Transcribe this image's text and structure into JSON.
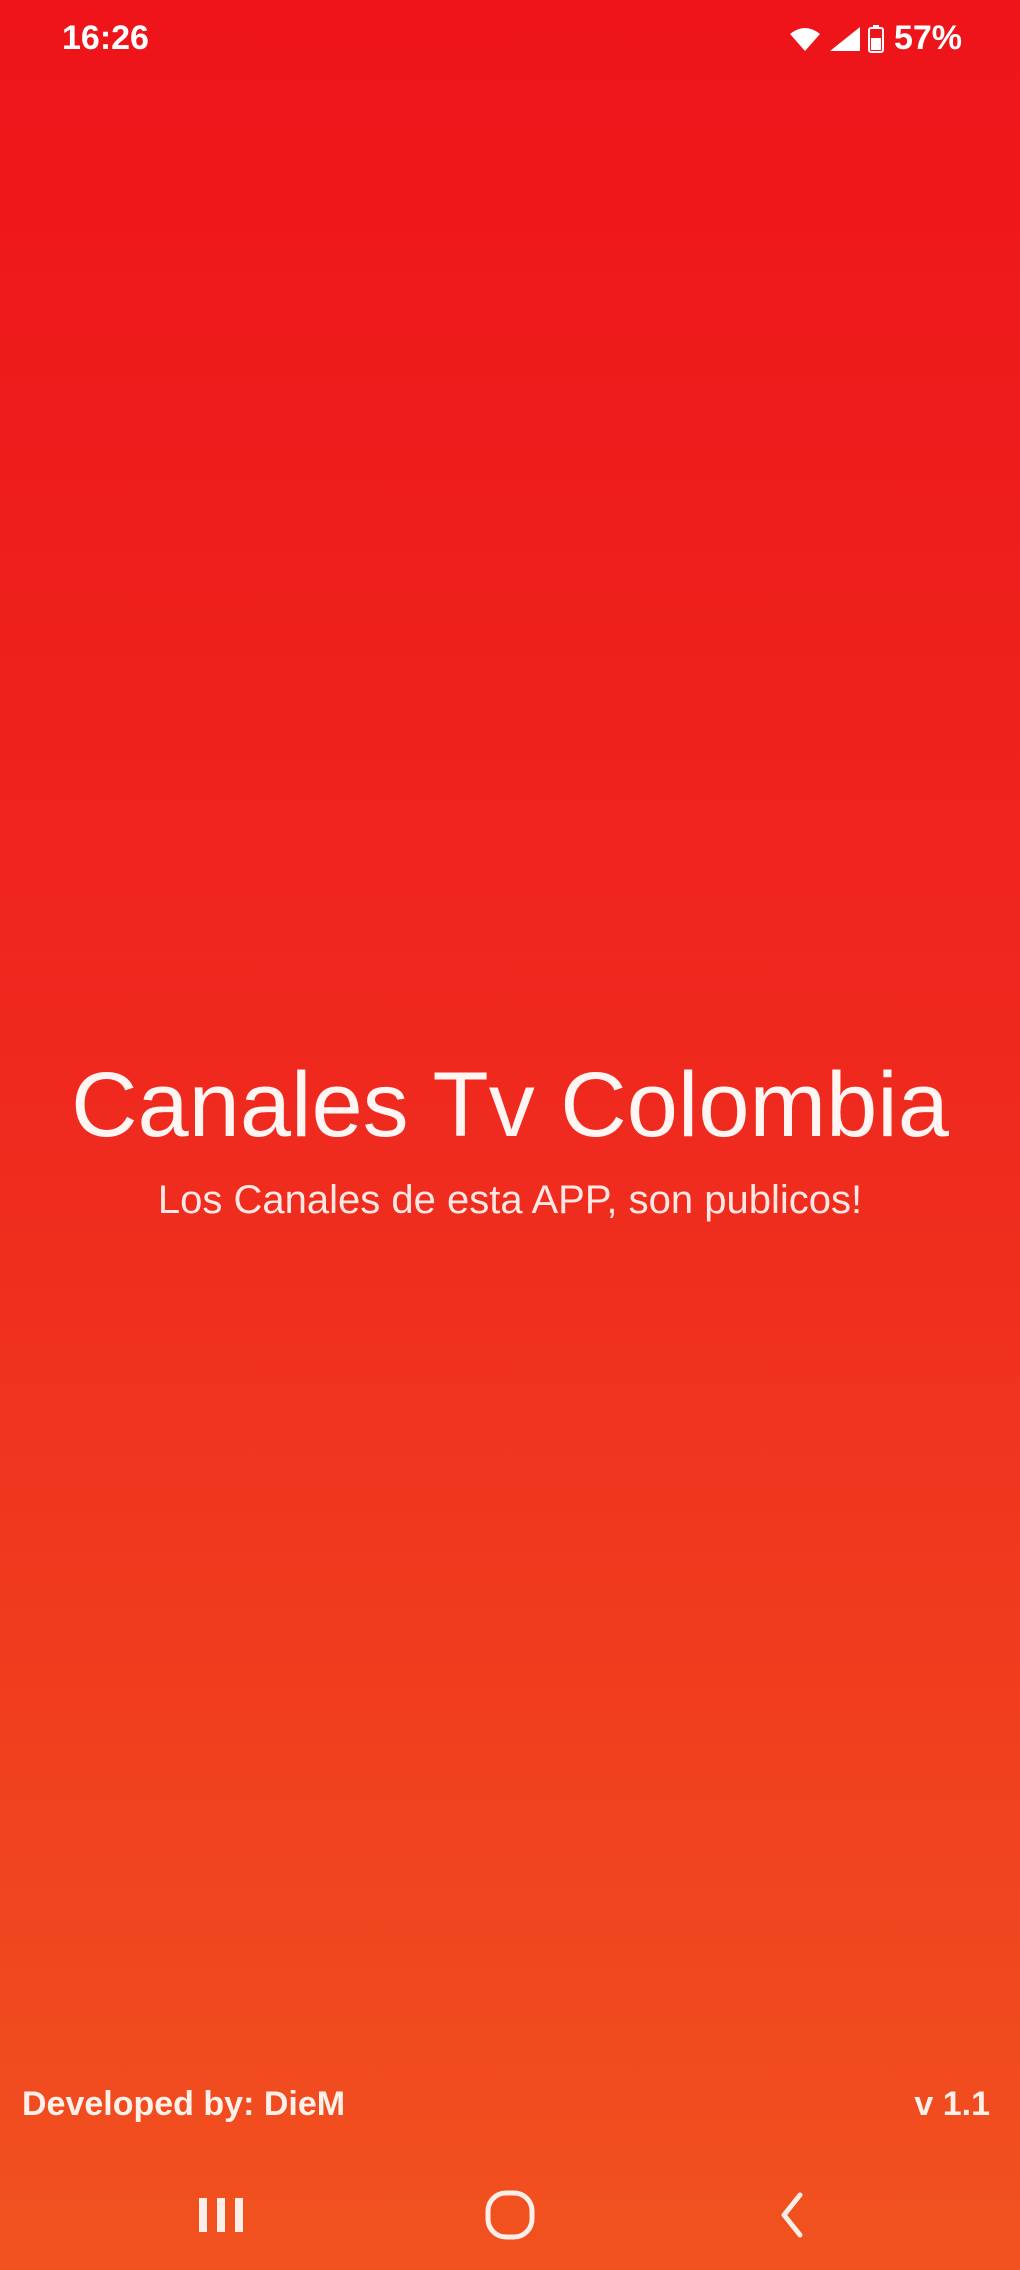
{
  "status_bar": {
    "time": "16:26",
    "battery": "57%",
    "icons": [
      "wifi-icon",
      "signal-icon",
      "battery-icon"
    ]
  },
  "main": {
    "title": "Canales Tv Colombia",
    "subtitle": "Los Canales de esta APP, son publicos!"
  },
  "footer": {
    "developer": "Developed by: DieM",
    "version": "v 1.1"
  },
  "nav_bar": {
    "icons": [
      "recent-apps-icon",
      "home-icon",
      "back-icon"
    ]
  },
  "colors": {
    "gradient_top": "#ee141a",
    "gradient_bottom": "#f1521f",
    "text": "#ffffff"
  }
}
